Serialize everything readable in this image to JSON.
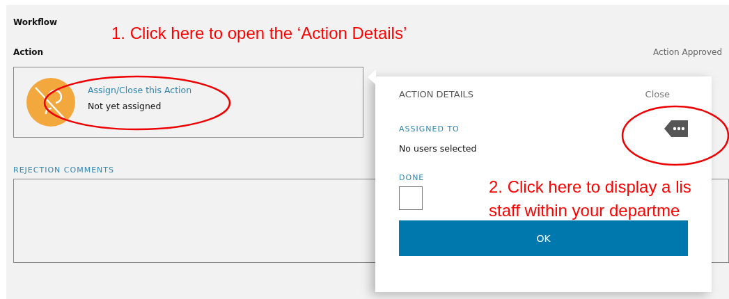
{
  "page": {
    "title": "Workflow",
    "section": "Action",
    "status": "Action Approved"
  },
  "action": {
    "link": "Assign/Close this Action",
    "assignee": "Not yet assigned"
  },
  "rejection_comments": {
    "label": "REJECTION COMMENTS"
  },
  "popup": {
    "title": "ACTION DETAILS",
    "close": "Close",
    "assigned_label": "ASSIGNED TO",
    "assigned_value": "No users selected",
    "done_label": "DONE",
    "done_checked": false,
    "ok": "OK"
  },
  "annotations": [
    {
      "lines": [
        "1. Click here to open the ‘Action Details’"
      ]
    },
    {
      "lines": [
        "2. Click here to display a lis",
        "staff within your departme"
      ]
    }
  ]
}
